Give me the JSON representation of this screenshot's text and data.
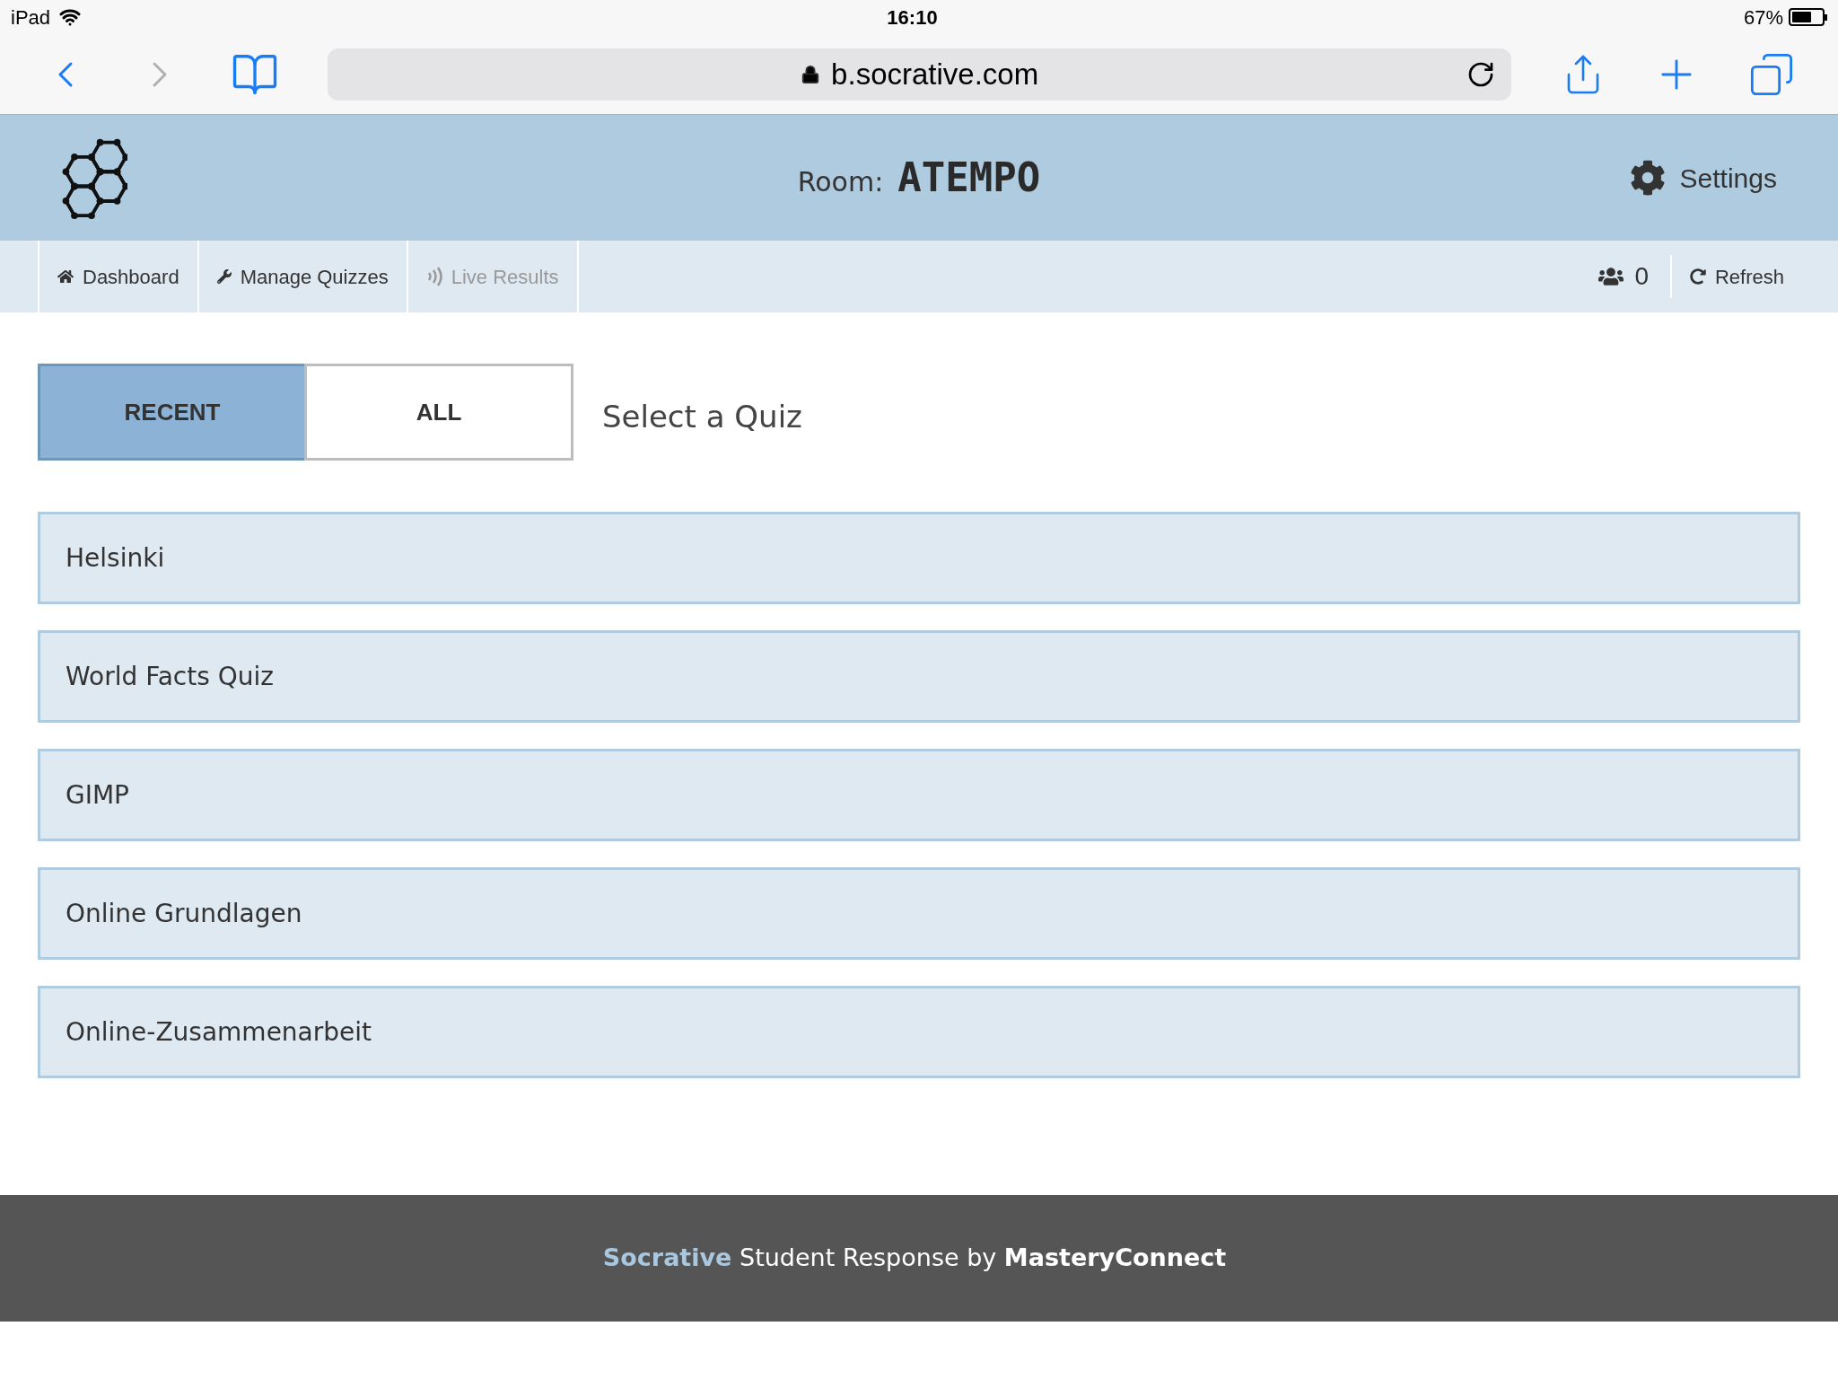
{
  "status_bar": {
    "device": "iPad",
    "time": "16:10",
    "battery": "67%"
  },
  "browser": {
    "url": "b.socrative.com"
  },
  "header": {
    "room_label": "Room:",
    "room_name": "ATEMPO",
    "settings": "Settings"
  },
  "nav": {
    "items": [
      {
        "label": "Dashboard",
        "kind": "home",
        "disabled": false
      },
      {
        "label": "Manage Quizzes",
        "kind": "wrench",
        "disabled": false
      },
      {
        "label": "Live Results",
        "kind": "signal",
        "disabled": true
      }
    ],
    "student_count": "0",
    "refresh": "Refresh"
  },
  "tabs": [
    {
      "label": "RECENT",
      "selected": true
    },
    {
      "label": "ALL",
      "selected": false
    }
  ],
  "heading": "Select a Quiz",
  "quizzes": [
    "Helsinki",
    "World Facts Quiz",
    "GIMP",
    "Online Grundlagen",
    "Online-Zusammenarbeit"
  ],
  "footer": {
    "brand": "Socrative",
    "text": "Student Response by",
    "company": "MasteryConnect"
  }
}
